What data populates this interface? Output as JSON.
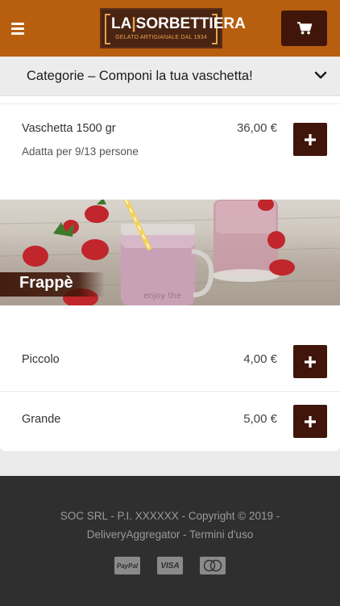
{
  "header": {
    "logo": {
      "title_left": "LA",
      "title_right": "SORBETTIERA",
      "subtitle": "GELATO ARTIGIANALE DAL 1934"
    },
    "menu_icon": "hamburger-icon",
    "cart_icon": "cart-icon",
    "colors": {
      "bar": "#b85e0f",
      "button": "#3f1609"
    }
  },
  "category_bar": {
    "label": "Categorie  –  Componi la tua vaschetta!",
    "chevron_icon": "chevron-down-icon"
  },
  "sections": [
    {
      "items": [
        {
          "name": "Vaschetta 1500 gr",
          "description": "Adatta per 9/13 persone",
          "price": "36,00 €"
        }
      ]
    },
    {
      "banner_title": "Frappè",
      "items": [
        {
          "name": "Piccolo",
          "price": "4,00 €"
        },
        {
          "name": "Grande",
          "price": "5,00 €"
        }
      ]
    }
  ],
  "add_icon": "plus-icon",
  "footer": {
    "line1": "SOC SRL - P.I. XXXXXX - Copyright © 2019 -",
    "line2": "DeliveryAggregator - Termini d'uso",
    "payments": [
      "PayPal",
      "VISA",
      "MasterCard"
    ]
  }
}
